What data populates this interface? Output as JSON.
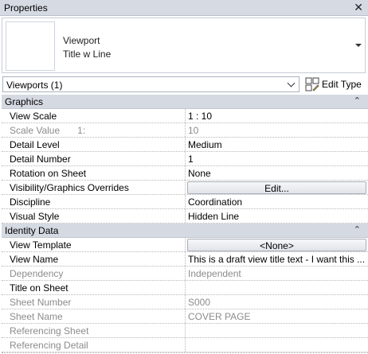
{
  "window": {
    "title": "Properties",
    "close_icon": "close-icon"
  },
  "type_selector": {
    "family": "Viewport",
    "type": "Title w Line"
  },
  "instance": {
    "selector_value": "Viewports (1)",
    "edit_type_label": "Edit Type"
  },
  "groups": {
    "graphics": {
      "name": "Graphics",
      "rows": {
        "view_scale": {
          "name": "View Scale",
          "value": "1 : 10"
        },
        "scale_value": {
          "name": "Scale Value",
          "unit": "1:",
          "value": "10"
        },
        "detail_level": {
          "name": "Detail Level",
          "value": "Medium"
        },
        "detail_number": {
          "name": "Detail Number",
          "value": "1"
        },
        "rotation": {
          "name": "Rotation on Sheet",
          "value": "None"
        },
        "vg_overrides": {
          "name": "Visibility/Graphics Overrides",
          "value": "Edit..."
        },
        "discipline": {
          "name": "Discipline",
          "value": "Coordination"
        },
        "visual_style": {
          "name": "Visual Style",
          "value": "Hidden Line"
        }
      }
    },
    "identity": {
      "name": "Identity Data",
      "rows": {
        "view_template": {
          "name": "View Template",
          "value": "<None>"
        },
        "view_name": {
          "name": "View Name",
          "value": "This is a draft view title text - I want this ..."
        },
        "dependency": {
          "name": "Dependency",
          "value": "Independent"
        },
        "title_on_sheet": {
          "name": "Title on Sheet",
          "value": ""
        },
        "sheet_number": {
          "name": "Sheet Number",
          "value": "S000"
        },
        "sheet_name": {
          "name": "Sheet Name",
          "value": "COVER PAGE"
        },
        "referencing_sheet": {
          "name": "Referencing Sheet",
          "value": ""
        },
        "referencing_detail": {
          "name": "Referencing Detail",
          "value": ""
        }
      }
    }
  },
  "colors": {
    "header_bg": "#d4d9e2",
    "title_bg": "#d5dae3",
    "dim_text": "#8c8c8c"
  }
}
